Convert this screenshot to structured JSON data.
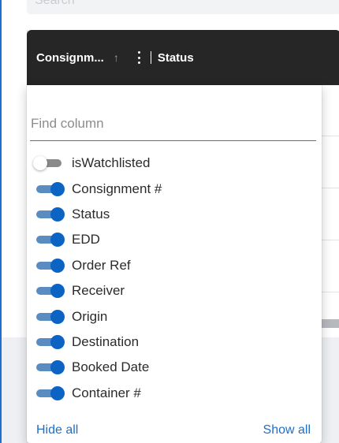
{
  "search": {
    "placeholder_partial": "Search"
  },
  "header": {
    "column_label": "Consignm...",
    "sort_glyph": "↑",
    "next_column_label": "Status"
  },
  "column_chooser": {
    "find_placeholder": "Find column",
    "find_value": "",
    "columns": [
      {
        "label": "isWatchlisted",
        "visible": false
      },
      {
        "label": "Consignment #",
        "visible": true
      },
      {
        "label": "Status",
        "visible": true
      },
      {
        "label": "EDD",
        "visible": true
      },
      {
        "label": "Order Ref",
        "visible": true
      },
      {
        "label": "Receiver",
        "visible": true
      },
      {
        "label": "Origin",
        "visible": true
      },
      {
        "label": "Destination",
        "visible": true
      },
      {
        "label": "Booked Date",
        "visible": true
      },
      {
        "label": "Container #",
        "visible": true
      }
    ],
    "hide_all_label": "Hide all",
    "show_all_label": "Show all"
  },
  "colors": {
    "accent": "#0b63c4",
    "toggle_track_on": "#5b8cc1",
    "header_bg": "#262626",
    "link": "#1f6fc5",
    "frame_border": "#1f6fd1"
  }
}
